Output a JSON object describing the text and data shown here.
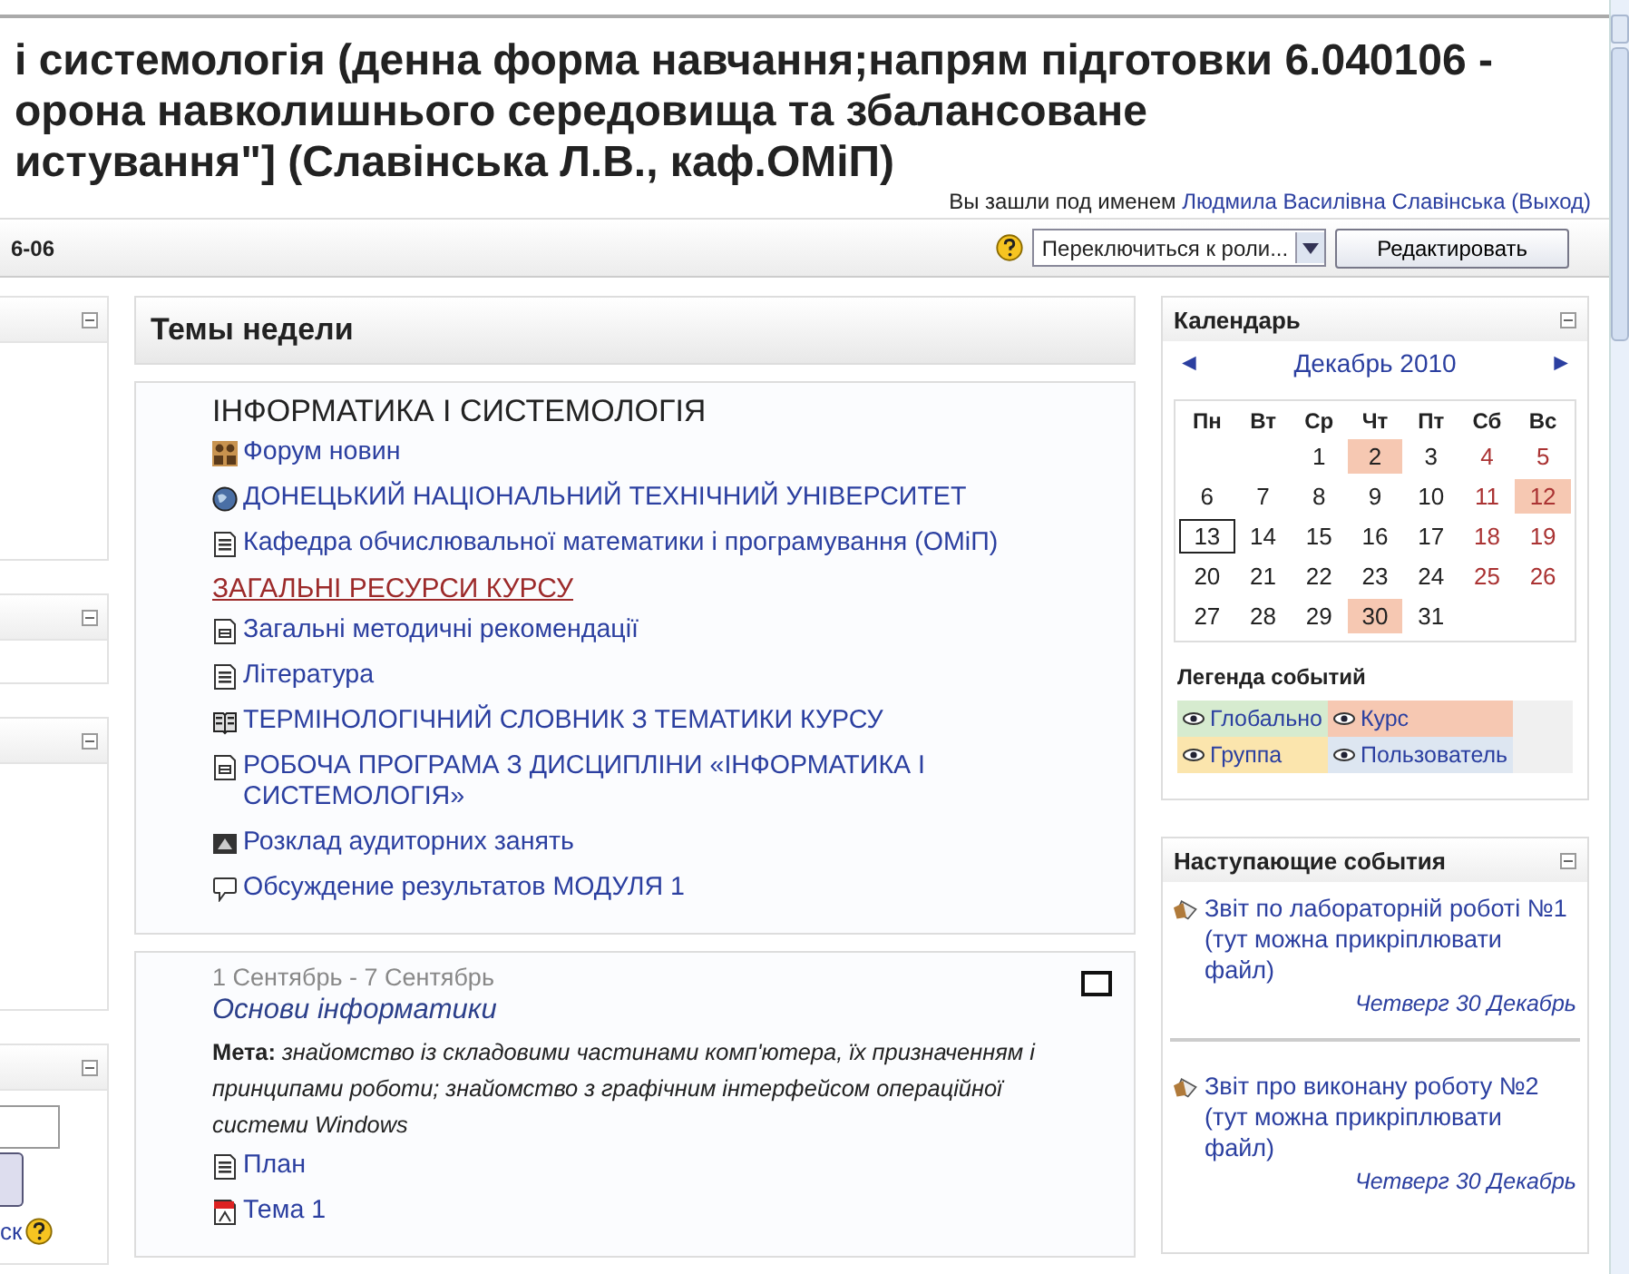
{
  "header": {
    "title_lines": [
      "і системологія (денна форма навчання;напрям підготовки 6.040106 -",
      "орона навколишнього середовища та збалансоване",
      "истування\"] (Славінська Л.В., каф.ОМіП)"
    ],
    "login": {
      "prefix": "Вы зашли под именем",
      "user": "Людмила Василівна Славінська",
      "logout": "(Выход)"
    }
  },
  "navbar": {
    "crumb": "6-06",
    "role_select": {
      "value": "Переключиться к роли..."
    },
    "edit_button": "Редактировать"
  },
  "left_column": {
    "search_label": "ск"
  },
  "weeks_title": "Темы недели",
  "section_0": {
    "title": "ІНФОРМАТИКА І СИСТЕМОЛОГІЯ",
    "items": [
      {
        "kind": "forum",
        "text": "Форум новин"
      },
      {
        "kind": "url",
        "text": "ДОНЕЦЬКИЙ НАЦІОНАЛЬНИЙ ТЕХНІЧНИЙ УНІВЕРСИТЕТ"
      },
      {
        "kind": "page",
        "text": "Кафедра обчислювальної математики і програмування (ОМіП)"
      },
      {
        "kind": "label",
        "text": "ЗАГАЛЬНІ РЕСУРСИ КУРСУ"
      },
      {
        "kind": "doc",
        "text": "Загальні методичні рекомендації"
      },
      {
        "kind": "page",
        "text": "Література"
      },
      {
        "kind": "glossary",
        "text": "ТЕРМІНОЛОГІЧНИЙ СЛОВНИК З ТЕМАТИКИ КУРСУ"
      },
      {
        "kind": "doc",
        "text": "РОБОЧА ПРОГРАМА З ДИСЦИПЛІНИ «ІНФОРМАТИКА І СИСТЕМОЛОГІЯ»"
      },
      {
        "kind": "image",
        "text": "Розклад аудиторних занять"
      },
      {
        "kind": "chat",
        "text": "Обсуждение результатов МОДУЛЯ 1"
      }
    ]
  },
  "section_1": {
    "dates": "1 Сентябрь - 7 Сентябрь",
    "title": "Основи інформатики",
    "goal": "**Мета:** *знайомство із складовими частинами комп'ютера, їх призначенням і принципами роботи; знайомство з графічним інтерфейсом операційної системи Windows*",
    "highlighted": false,
    "items": [
      {
        "kind": "page",
        "text": "План"
      },
      {
        "kind": "pdf",
        "text": "Тема 1"
      }
    ]
  },
  "calendar": {
    "title": "Календарь",
    "month": "Декабрь 2010",
    "prev": "◄",
    "next": "►",
    "weekdays": [
      "Пн",
      "Вт",
      "Ср",
      "Чт",
      "Пт",
      "Сб",
      "Вс"
    ],
    "weeks": [
      {
        "right_aligned": true,
        "days": [
          {
            "day": "1",
            "weekend": false,
            "event": false,
            "today": false
          },
          {
            "day": "2",
            "weekend": false,
            "event": true,
            "today": false
          },
          {
            "day": "3",
            "weekend": false,
            "event": false,
            "today": false
          },
          {
            "day": "4",
            "weekend": true,
            "event": false,
            "today": false
          },
          {
            "day": "5",
            "weekend": true,
            "event": false,
            "today": false
          }
        ]
      },
      {
        "days": [
          {
            "day": "6",
            "weekend": false,
            "event": false,
            "today": false
          },
          {
            "day": "7",
            "weekend": false,
            "event": false,
            "today": false
          },
          {
            "day": "8",
            "weekend": false,
            "event": false,
            "today": false
          },
          {
            "day": "9",
            "weekend": false,
            "event": false,
            "today": false
          },
          {
            "day": "10",
            "weekend": false,
            "event": false,
            "today": false
          },
          {
            "day": "11",
            "weekend": true,
            "event": false,
            "today": false
          },
          {
            "day": "12",
            "weekend": true,
            "event": true,
            "today": false
          }
        ]
      },
      {
        "days": [
          {
            "day": "13",
            "weekend": false,
            "event": false,
            "today": true
          },
          {
            "day": "14",
            "weekend": false,
            "event": false,
            "today": false
          },
          {
            "day": "15",
            "weekend": false,
            "event": false,
            "today": false
          },
          {
            "day": "16",
            "weekend": false,
            "event": false,
            "today": false
          },
          {
            "day": "17",
            "weekend": false,
            "event": false,
            "today": false
          },
          {
            "day": "18",
            "weekend": true,
            "event": false,
            "today": false
          },
          {
            "day": "19",
            "weekend": true,
            "event": false,
            "today": false
          }
        ]
      },
      {
        "days": [
          {
            "day": "20",
            "weekend": false,
            "event": false,
            "today": false
          },
          {
            "day": "21",
            "weekend": false,
            "event": false,
            "today": false
          },
          {
            "day": "22",
            "weekend": false,
            "event": false,
            "today": false
          },
          {
            "day": "23",
            "weekend": false,
            "event": false,
            "today": false
          },
          {
            "day": "24",
            "weekend": false,
            "event": false,
            "today": false
          },
          {
            "day": "25",
            "weekend": true,
            "event": false,
            "today": false
          },
          {
            "day": "26",
            "weekend": true,
            "event": false,
            "today": false
          }
        ]
      },
      {
        "right_aligned": false,
        "days": [
          {
            "day": "27",
            "weekend": false,
            "event": false,
            "today": false
          },
          {
            "day": "28",
            "weekend": false,
            "event": false,
            "today": false
          },
          {
            "day": "29",
            "weekend": false,
            "event": false,
            "today": false
          },
          {
            "day": "30",
            "weekend": false,
            "event": true,
            "today": false
          },
          {
            "day": "31",
            "weekend": false,
            "event": false,
            "today": false
          }
        ]
      }
    ],
    "legend_title": "Легенда событий",
    "legend": [
      {
        "text": "Глобально",
        "color": "#d6ebcf"
      },
      {
        "text": "Курс",
        "color": "#f6c8b2"
      },
      {
        "text": "Группа",
        "color": "#fbe5ad"
      },
      {
        "text": "Пользователь",
        "color": "#dde6f1"
      }
    ]
  },
  "upcoming": {
    "title": "Наступающие события",
    "events": [
      {
        "text": "Звіт по лабораторній роботі №1 (тут можна прикріплювати файл)",
        "date": "Четверг 30 Декабрь"
      },
      {
        "text": "Звіт про виконану роботу №2 (тут можна прикріплювати файл)",
        "date": "Четверг 30 Декабрь"
      }
    ]
  }
}
